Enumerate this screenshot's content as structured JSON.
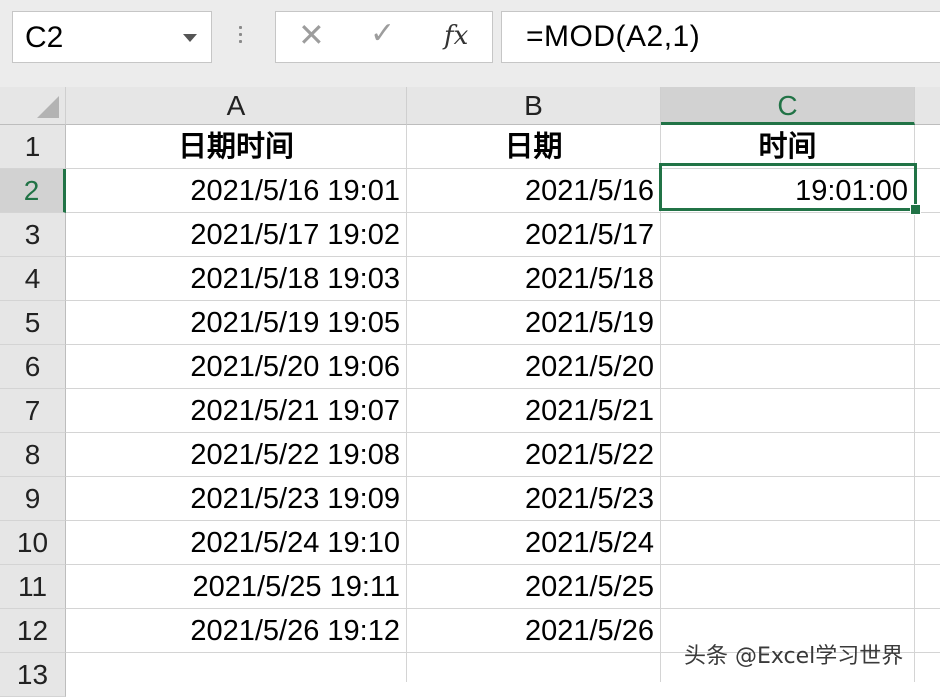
{
  "name_box": {
    "value": "C2"
  },
  "formula_bar": {
    "cancel_glyph": "✕",
    "enter_glyph": "✓",
    "function_glyph": "fx",
    "formula": "=MOD(A2,1)"
  },
  "columns": [
    "A",
    "B",
    "C"
  ],
  "rows": [
    "1",
    "2",
    "3",
    "4",
    "5",
    "6",
    "7",
    "8",
    "9",
    "10",
    "11",
    "12",
    "13"
  ],
  "headers": {
    "A": "日期时间",
    "B": "日期",
    "C": "时间"
  },
  "data": [
    {
      "a": "2021/5/16 19:01",
      "b": "2021/5/16",
      "c": "19:01:00"
    },
    {
      "a": "2021/5/17 19:02",
      "b": "2021/5/17",
      "c": ""
    },
    {
      "a": "2021/5/18 19:03",
      "b": "2021/5/18",
      "c": ""
    },
    {
      "a": "2021/5/19 19:05",
      "b": "2021/5/19",
      "c": ""
    },
    {
      "a": "2021/5/20 19:06",
      "b": "2021/5/20",
      "c": ""
    },
    {
      "a": "2021/5/21 19:07",
      "b": "2021/5/21",
      "c": ""
    },
    {
      "a": "2021/5/22 19:08",
      "b": "2021/5/22",
      "c": ""
    },
    {
      "a": "2021/5/23 19:09",
      "b": "2021/5/23",
      "c": ""
    },
    {
      "a": "2021/5/24 19:10",
      "b": "2021/5/24",
      "c": ""
    },
    {
      "a": "2021/5/25 19:11",
      "b": "2021/5/25",
      "c": ""
    },
    {
      "a": "2021/5/26 19:12",
      "b": "2021/5/26",
      "c": ""
    }
  ],
  "active_cell": "C2",
  "watermark": "头条 @Excel学习世界",
  "colors": {
    "accent": "#217346",
    "header_bg": "#e6e6e6",
    "header_selected_bg": "#d2d2d2",
    "grid": "#d4d4d4"
  }
}
